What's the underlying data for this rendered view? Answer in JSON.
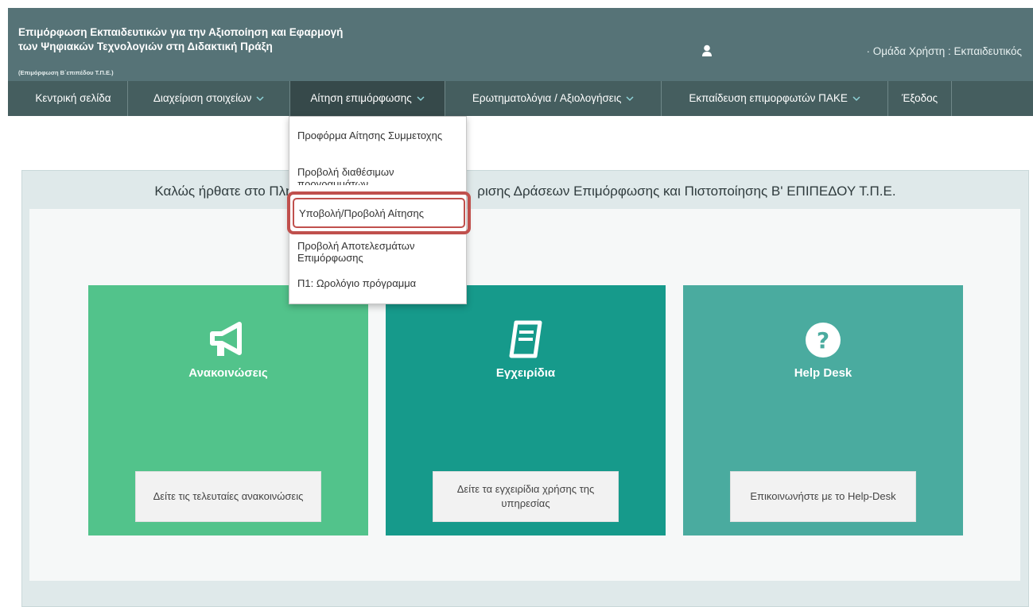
{
  "header": {
    "title_line1": "Επιμόρφωση Εκπαιδευτικών για την Αξιοποίηση και Εφαρμογή",
    "title_line2": "των Ψηφιακών Τεχνολογιών στη Διδακτική Πράξη",
    "subtitle": "(Επιμόρφωση Β΄επιπέδου Τ.Π.Ε.)",
    "user_icon": "user-icon",
    "user_group": "· Ομάδα Χρήστη : Εκπαιδευτικός"
  },
  "nav": {
    "items": [
      {
        "label": "Κεντρική σελίδα"
      },
      {
        "label": "Διαχείριση στοιχείων"
      },
      {
        "label": "Αίτηση επιμόρφωσης"
      },
      {
        "label": "Ερωτηματολόγια / Αξιολογήσεις"
      },
      {
        "label": "Εκπαίδευση επιμορφωτών ΠΑΚΕ"
      },
      {
        "label": "Έξοδος"
      }
    ]
  },
  "dropdown": {
    "items": [
      {
        "label": "Προφόρμα Αίτησης Συμμετοχης"
      },
      {
        "label": "Προβολή διαθέσιμων προγραμμάτων"
      },
      {
        "label": "Υποβολή/Προβολή Αίτησης"
      },
      {
        "label": "Προβολή Αποτελεσμάτων Επιμόρφωσης"
      },
      {
        "label": "Π1: Ωρολόγιο πρόγραμμα"
      }
    ]
  },
  "welcome": {
    "text_left": "Καλώς ήρθατε στο Πληρ",
    "text_right": "ρισης Δράσεων Επιμόρφωσης και Πιστοποίησης Β' ΕΠΙΠΕΔΟΥ Τ.Π.Ε."
  },
  "cards": [
    {
      "title": "Ανακοινώσεις",
      "icon": "megaphone-icon",
      "button": "Δείτε τις τελευταίες ανακοινώσεις",
      "color": "#52c38b"
    },
    {
      "title": "Εγχειρίδια",
      "icon": "book-icon",
      "button": "Δείτε τα εγχειρίδια χρήσης της υπηρεσίας",
      "color": "#169a8b"
    },
    {
      "title": "Help Desk",
      "icon": "question-icon",
      "button": "Επικοινωνήστε με το Help-Desk",
      "color": "#4aab9f"
    }
  ],
  "colors": {
    "header_bg": "#567377",
    "navbar_bg": "#455e5f",
    "highlight": "#c0504d"
  }
}
